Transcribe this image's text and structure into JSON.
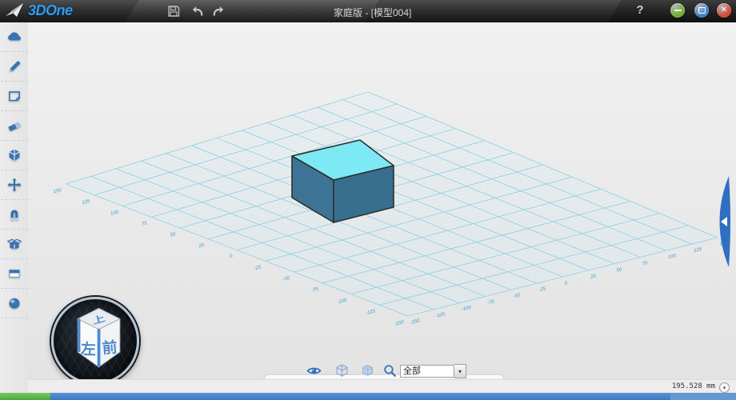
{
  "colors": {
    "icon_blue": "#3b72b4",
    "logo_blue": "#2f9df2",
    "grid_minor": "#cfecf5",
    "grid_major": "#8fd3e7",
    "grid_label": "#2f9fd0",
    "box_top": "#7de9f4",
    "box_left": "#3d7495",
    "box_right": "#386e8e",
    "box_edge": "#2f2f2f",
    "navcube_char_blue": "#4d89cc",
    "tab_blue": "#2f6fc2",
    "strip_green": "#4aa63f",
    "strip_blue": "#3b79c4",
    "strip_blue_light": "#6598d2",
    "btn_minimize_green": "#6fb02c",
    "btn_restore_blue": "#3a7fd0",
    "btn_close_red": "#d24a38"
  },
  "titlebar": {
    "logo_text": "3DOne",
    "document_title": "家庭版 - [模型004]",
    "help_label": "?",
    "tool_icons": [
      "save-icon",
      "undo-arrow-icon",
      "redo-arrow-icon"
    ],
    "window_icons": [
      "minimize-icon",
      "restore-icon",
      "close-icon"
    ],
    "close_glyph": "✕"
  },
  "sidebar": {
    "items": [
      {
        "name": "community",
        "icon": "cloud-icon"
      },
      {
        "name": "sketch",
        "icon": "pen-icon"
      },
      {
        "name": "surface",
        "icon": "plane-icon"
      },
      {
        "name": "edit",
        "icon": "eraser-icon"
      },
      {
        "name": "solid",
        "icon": "cube-icon"
      },
      {
        "name": "transform",
        "icon": "move-icon"
      },
      {
        "name": "assembly",
        "icon": "magnet-icon"
      },
      {
        "name": "special-shape",
        "icon": "open-box-icon"
      },
      {
        "name": "section",
        "icon": "layers-icon"
      },
      {
        "name": "render",
        "icon": "sphere-icon"
      }
    ]
  },
  "viewport": {
    "grid": {
      "left_edge_labels": [
        "150",
        "125",
        "100",
        "75",
        "50",
        "25",
        "0",
        "-25",
        "-50",
        "-75",
        "-100",
        "-125",
        "-150"
      ],
      "right_edge_labels": [
        "-150",
        "-125",
        "-100",
        "-75",
        "-50",
        "-25",
        "0",
        "25",
        "50",
        "75",
        "100",
        "125",
        "150"
      ]
    },
    "box": {},
    "navcube": {
      "top_label": "上",
      "left_label": "左",
      "front_label": "前"
    },
    "expand_tab": {
      "icon": "triangle-left-icon"
    }
  },
  "bottom_toolbar": {
    "icons": [
      "eye-icon",
      "wireframe-cube-icon",
      "shaded-cube-icon",
      "zoom-icon"
    ],
    "filter": {
      "value": "全部",
      "arrow_glyph": "▾"
    }
  },
  "statusbar": {
    "measurement": "195.528 mm",
    "unit_dropdown_glyph": "▾"
  }
}
